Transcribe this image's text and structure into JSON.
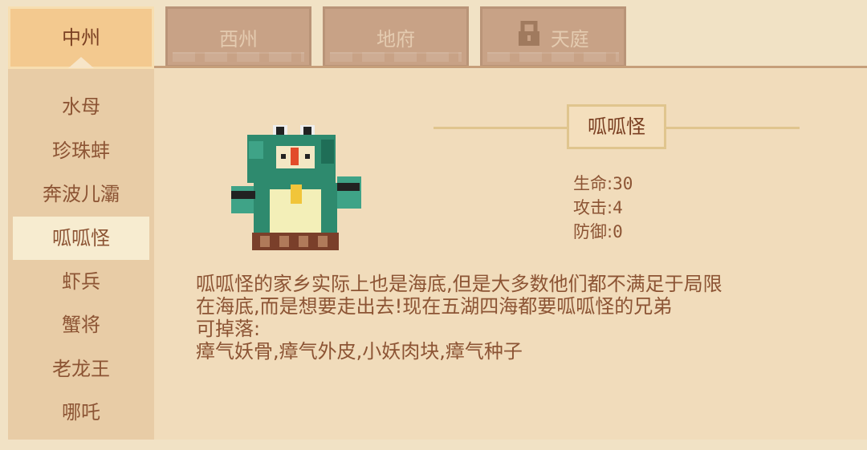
{
  "tabs": [
    {
      "label": "中州",
      "active": true,
      "locked": false
    },
    {
      "label": "西州",
      "active": false,
      "locked": false
    },
    {
      "label": "地府",
      "active": false,
      "locked": false
    },
    {
      "label": "天庭",
      "active": false,
      "locked": true
    }
  ],
  "sidebar": {
    "items": [
      {
        "label": "水母"
      },
      {
        "label": "珍珠蚌"
      },
      {
        "label": "奔波儿灞"
      },
      {
        "label": "呱呱怪",
        "selected": true
      },
      {
        "label": "虾兵"
      },
      {
        "label": "蟹将"
      },
      {
        "label": "老龙王"
      },
      {
        "label": "哪吒"
      }
    ]
  },
  "monster": {
    "name": "呱呱怪",
    "stats": [
      {
        "label": "生命:",
        "value": "30"
      },
      {
        "label": "攻击:",
        "value": "4"
      },
      {
        "label": "防御:",
        "value": "0"
      }
    ],
    "description_lines": [
      "呱呱怪的家乡实际上也是海底,但是大多数他们都不满足于局限",
      "在海底,而是想要走出去!现在五湖四海都要呱呱怪的兄弟",
      "可掉落:",
      "瘴气妖骨,瘴气外皮,小妖肉块,瘴气种子"
    ]
  },
  "colors": {
    "background": "#f1e2c5",
    "active_tab": "#f3c98f",
    "inactive_tab": "#c8a286",
    "sidebar": "#e8cca6",
    "selected_item": "#f7ecd0",
    "text": "#8c5434"
  },
  "icons": {
    "locked_tab": "lock-icon",
    "monster_portrait": "frog-monster-icon"
  }
}
